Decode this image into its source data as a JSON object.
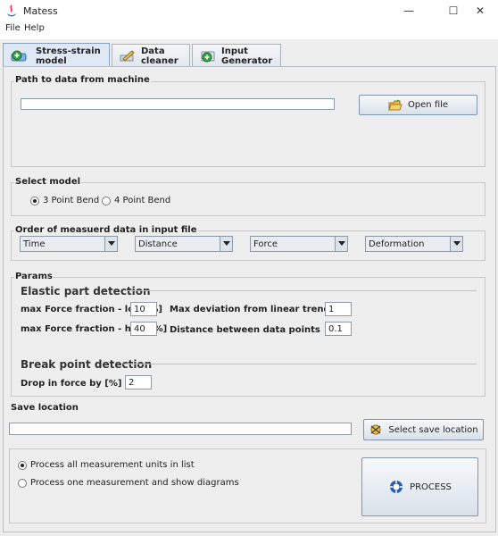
{
  "window": {
    "title": "Matess"
  },
  "menu": [
    {
      "label": "File"
    },
    {
      "label": "Help"
    }
  ],
  "tabs": [
    {
      "label": "Stress-strain model",
      "icon": "plus-circle-icon"
    },
    {
      "label": "Data cleaner",
      "icon": "pen-icon"
    },
    {
      "label": "Input Generator",
      "icon": "plus-circle-icon"
    }
  ],
  "path_group": {
    "title": "Path to data from machine",
    "path_value": "",
    "open_label": "Open file"
  },
  "model_group": {
    "title": "Select model",
    "options": [
      {
        "label": "3 Point Bend",
        "selected": true
      },
      {
        "label": "4 Point Bend",
        "selected": false
      }
    ]
  },
  "order_group": {
    "title": "Order of measuerd data in input file",
    "combos": [
      "Time",
      "Distance",
      "Force",
      "Deformation"
    ]
  },
  "params": {
    "title": "Params",
    "elastic_title": "Elastic part detection",
    "max_force_low_label": "max Force fraction - low [%]",
    "max_force_low_value": "10",
    "max_force_high_label": "max Force fraction - high [%]",
    "max_force_high_value": "40",
    "max_dev_label": "Max deviation from linear trend [%]",
    "max_dev_value": "1",
    "distance_label": "Distance between data points",
    "distance_value": "0.1",
    "break_title": "Break point detection",
    "drop_label": "Drop in force by [%]",
    "drop_value": "2"
  },
  "save": {
    "title": "Save location",
    "path_value": "",
    "button_label": "Select save location"
  },
  "process": {
    "options": [
      {
        "label": "Process all measurement units in list",
        "selected": true
      },
      {
        "label": "Process one measurement and show diagrams",
        "selected": false
      }
    ],
    "button_label": "PROCESS"
  }
}
